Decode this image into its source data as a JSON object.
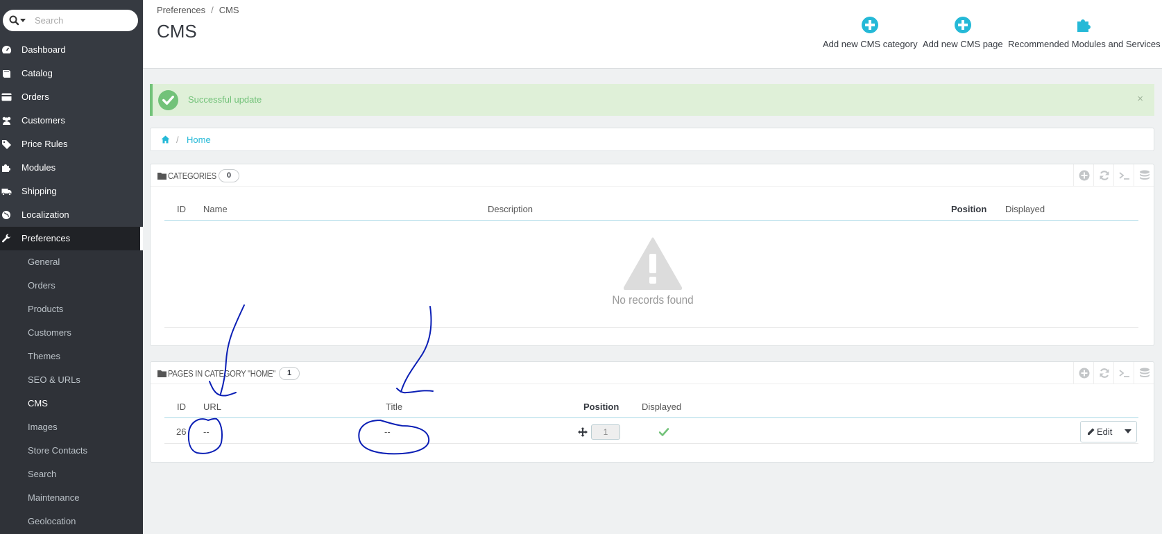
{
  "sidebar": {
    "search_placeholder": "Search",
    "items": [
      {
        "label": "Dashboard",
        "icon": "dashboard-icon"
      },
      {
        "label": "Catalog",
        "icon": "book-icon"
      },
      {
        "label": "Orders",
        "icon": "credit-card-icon"
      },
      {
        "label": "Customers",
        "icon": "users-icon"
      },
      {
        "label": "Price Rules",
        "icon": "tags-icon"
      },
      {
        "label": "Modules",
        "icon": "puzzle-icon"
      },
      {
        "label": "Shipping",
        "icon": "truck-icon"
      },
      {
        "label": "Localization",
        "icon": "globe-icon"
      },
      {
        "label": "Preferences",
        "icon": "wrench-icon",
        "active": true
      }
    ],
    "subitems": [
      {
        "label": "General"
      },
      {
        "label": "Orders"
      },
      {
        "label": "Products"
      },
      {
        "label": "Customers"
      },
      {
        "label": "Themes"
      },
      {
        "label": "SEO & URLs"
      },
      {
        "label": "CMS",
        "active": true
      },
      {
        "label": "Images"
      },
      {
        "label": "Store Contacts"
      },
      {
        "label": "Search"
      },
      {
        "label": "Maintenance"
      },
      {
        "label": "Geolocation"
      }
    ]
  },
  "header": {
    "breadcrumb": [
      "Preferences",
      "CMS"
    ],
    "breadcrumb_sep": "/",
    "title": "CMS",
    "toolbar": [
      {
        "label": "Add new CMS category",
        "icon": "plus-circle-icon"
      },
      {
        "label": "Add new CMS page",
        "icon": "plus-circle-icon"
      },
      {
        "label": "Recommended Modules and Services",
        "icon": "puzzle-icon"
      }
    ]
  },
  "alert": {
    "message": "Successful update",
    "close": "×",
    "color": "#72c279"
  },
  "tree": {
    "sep": "/",
    "home": "Home"
  },
  "categories_panel": {
    "title": "CATEGORIES",
    "count": "0",
    "columns": {
      "id": "ID",
      "name": "Name",
      "description": "Description",
      "position": "Position",
      "displayed": "Displayed"
    },
    "empty_text": "No records found"
  },
  "pages_panel": {
    "title": "PAGES IN CATEGORY \"HOME\"",
    "count": "1",
    "columns": {
      "id": "ID",
      "url": "URL",
      "title": "Title",
      "position": "Position",
      "displayed": "Displayed"
    },
    "rows": [
      {
        "id": "26",
        "url": "--",
        "title": "--",
        "position": "1",
        "displayed": true,
        "action": "Edit"
      }
    ]
  },
  "colors": {
    "accent": "#25b9d7",
    "sidebar": "#363a41",
    "success": "#72c279",
    "annotation": "#0b1fb5"
  }
}
